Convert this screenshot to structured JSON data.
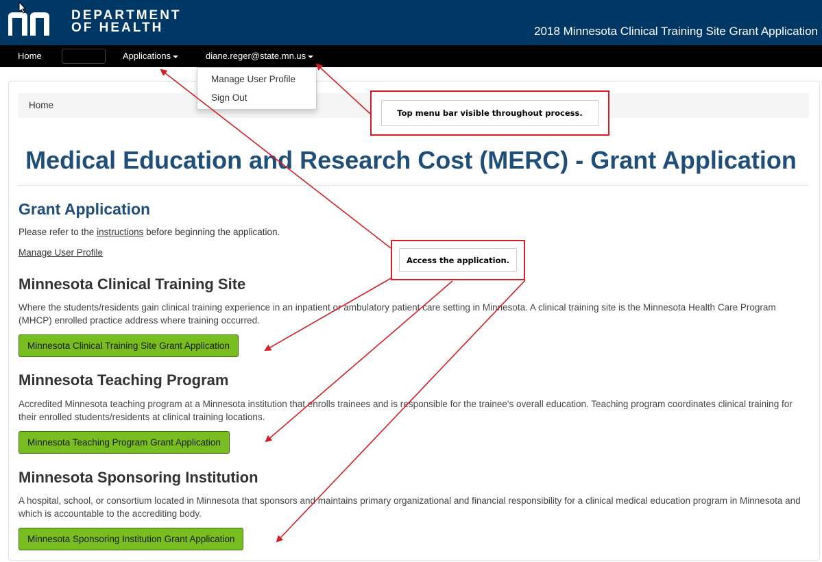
{
  "header": {
    "logo_line1": "DEPARTMENT",
    "logo_line2": "OF HEALTH",
    "app_title": "2018 Minnesota Clinical Training Site Grant Application",
    "colors": {
      "header_bg": "#003865",
      "nav_bg": "#000000",
      "button_bg": "#78be21",
      "title_color": "#1f4e79",
      "annotation_red": "#d21f26"
    }
  },
  "nav": {
    "home": "Home",
    "applications": "Applications",
    "user": "diane.reger@state.mn.us"
  },
  "dropdown": {
    "items": [
      "Manage User Profile",
      "Sign Out"
    ]
  },
  "breadcrumb": {
    "home": "Home"
  },
  "page": {
    "title": "Medical Education and Research Cost (MERC) - Grant Application",
    "grant_heading": "Grant Application",
    "instructions_pre": "Please refer to the ",
    "instructions_link": "instructions",
    "instructions_post": " before beginning the application.",
    "manage_profile": "Manage User Profile"
  },
  "sections": [
    {
      "heading": "Minnesota Clinical Training Site",
      "description": "Where the students/residents gain clinical training experience in an inpatient or ambulatory patient care setting in Minnesota. A clinical training site is the Minnesota Health Care Program (MHCP) enrolled practice address where training occurred.",
      "button": "Minnesota Clinical Training Site Grant Application"
    },
    {
      "heading": "Minnesota Teaching Program",
      "description": "Accredited Minnesota teaching program at a Minnesota institution that enrolls trainees and is responsible for the trainee's overall education. Teaching program coordinates clinical training for their enrolled students/residents at clinical training locations.",
      "button": "Minnesota Teaching Program Grant Application"
    },
    {
      "heading": "Minnesota Sponsoring Institution",
      "description": "A hospital, school, or consortium located in Minnesota that sponsors and maintains primary organizational and financial responsibility for a clinical medical education program in Minnesota and which is accountable to the accrediting body.",
      "button": "Minnesota Sponsoring Institution Grant Application"
    }
  ],
  "annotations": {
    "top_menu": "Top menu bar visible throughout process.",
    "access": "Access the application."
  }
}
